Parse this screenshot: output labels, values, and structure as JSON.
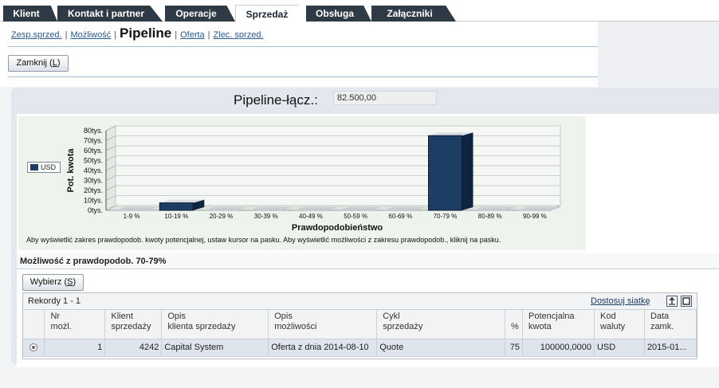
{
  "tabs": [
    {
      "label": "Klient",
      "active": false
    },
    {
      "label": "Kontakt i partner",
      "active": false
    },
    {
      "label": "Operacje",
      "active": false
    },
    {
      "label": "Sprzedaż",
      "active": true
    },
    {
      "label": "Obsługa",
      "active": false
    },
    {
      "label": "Załączniki",
      "active": false
    }
  ],
  "subnav": {
    "link1": "Zesp.sprzed.",
    "link2": "Możliwość",
    "current": "Pipeline",
    "link3": "Oferta",
    "link4": "Zlec. sprzed.",
    "sep": "|"
  },
  "close_button": {
    "label": "Zamknij",
    "key": "L"
  },
  "pipeline": {
    "label": "Pipeline-łącz.:",
    "value": "82.500,00"
  },
  "chart_data": {
    "type": "bar",
    "categories": [
      "1-9 %",
      "10-19 %",
      "20-29 %",
      "30-39 %",
      "40-49 %",
      "50-59 %",
      "60-69 %",
      "70-79 %",
      "80-89 %",
      "90-99 %"
    ],
    "series": [
      {
        "name": "USD",
        "values": [
          0,
          7500,
          0,
          0,
          0,
          0,
          0,
          75000,
          0,
          0
        ]
      }
    ],
    "ylabel": "Pot. kwota",
    "xlabel": "Prawdopodobieństwo",
    "yticks": [
      "80tys.",
      "70tys.",
      "60tys.",
      "50tys.",
      "40tys.",
      "30tys.",
      "20tys.",
      "10tys.",
      "0tys."
    ],
    "ylim": [
      0,
      80000
    ],
    "legend_position": "left",
    "bar_color": "#1d3e64",
    "note": "Aby wyświetlić zakres prawdopodob. kwoty potencjalnej, ustaw kursor na pasku. Aby wyświetlić możliwości z zakresu prawdopodob., kliknij na pasku."
  },
  "section": {
    "title": "Możliwość z prawdopodob. 70-79%"
  },
  "select_button": {
    "label": "Wybierz",
    "key": "S"
  },
  "grid": {
    "records": "Rekordy 1 - 1",
    "customize": "Dostosuj siatkę",
    "columns": [
      {
        "l1": "Nr",
        "l2": "możl."
      },
      {
        "l1": "Klient",
        "l2": "sprzedaży"
      },
      {
        "l1": "Opis",
        "l2": "klienta sprzedaży"
      },
      {
        "l1": "Opis",
        "l2": "możliwości"
      },
      {
        "l1": "Cykl",
        "l2": "sprzedaży"
      },
      {
        "l1": "",
        "l2": "%"
      },
      {
        "l1": "Potencjalna",
        "l2": "kwota"
      },
      {
        "l1": "Kod",
        "l2": "waluty"
      },
      {
        "l1": "Data",
        "l2": "zamk."
      }
    ],
    "rows": [
      [
        "1",
        "4242",
        "Capital System",
        "Oferta z dnia 2014-08-10",
        "Quote",
        "75",
        "100000,0000",
        "USD",
        "2015-01..."
      ]
    ]
  },
  "colors": {
    "tab_dark": "#2f3a47",
    "bar": "#1d3e64",
    "panel": "#e2e8ee",
    "link": "#2a5a8c"
  }
}
